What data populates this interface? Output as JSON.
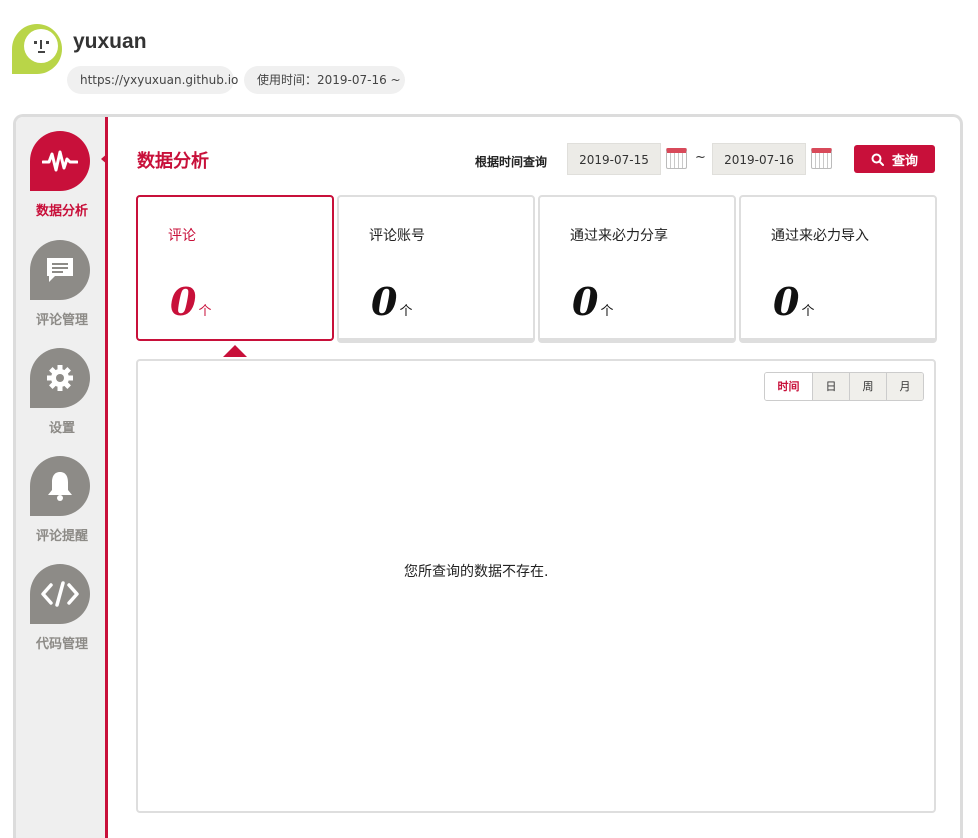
{
  "header": {
    "username": "yuxuan",
    "url": "https://yxyuxuan.github.io",
    "since": "使用时间：2019-07-16 ~"
  },
  "sidebar": {
    "items": [
      {
        "label": "数据分析",
        "icon": "pulse-icon",
        "active": true
      },
      {
        "label": "评论管理",
        "icon": "comment-icon",
        "active": false
      },
      {
        "label": "设置",
        "icon": "gear-icon",
        "active": false
      },
      {
        "label": "评论提醒",
        "icon": "bell-icon",
        "active": false
      },
      {
        "label": "代码管理",
        "icon": "code-icon",
        "active": false
      }
    ]
  },
  "main": {
    "title": "数据分析",
    "query_label": "根据时间查询",
    "date_from": "2019-07-15",
    "date_to": "2019-07-16",
    "tilde": "~",
    "search_label": "查询",
    "cards": [
      {
        "title": "评论",
        "value": "0",
        "unit": "个",
        "active": true
      },
      {
        "title": "评论账号",
        "value": "0",
        "unit": "个",
        "active": false
      },
      {
        "title": "通过来必力分享",
        "value": "0",
        "unit": "个",
        "active": false
      },
      {
        "title": "通过来必力导入",
        "value": "0",
        "unit": "个",
        "active": false
      }
    ],
    "range_buttons": [
      "时间",
      "日",
      "周",
      "月"
    ],
    "empty_message": "您所查询的数据不存在."
  },
  "colors": {
    "accent": "#c8103a",
    "logo": "#b9d548",
    "nav_inactive": "#8d8b87"
  }
}
